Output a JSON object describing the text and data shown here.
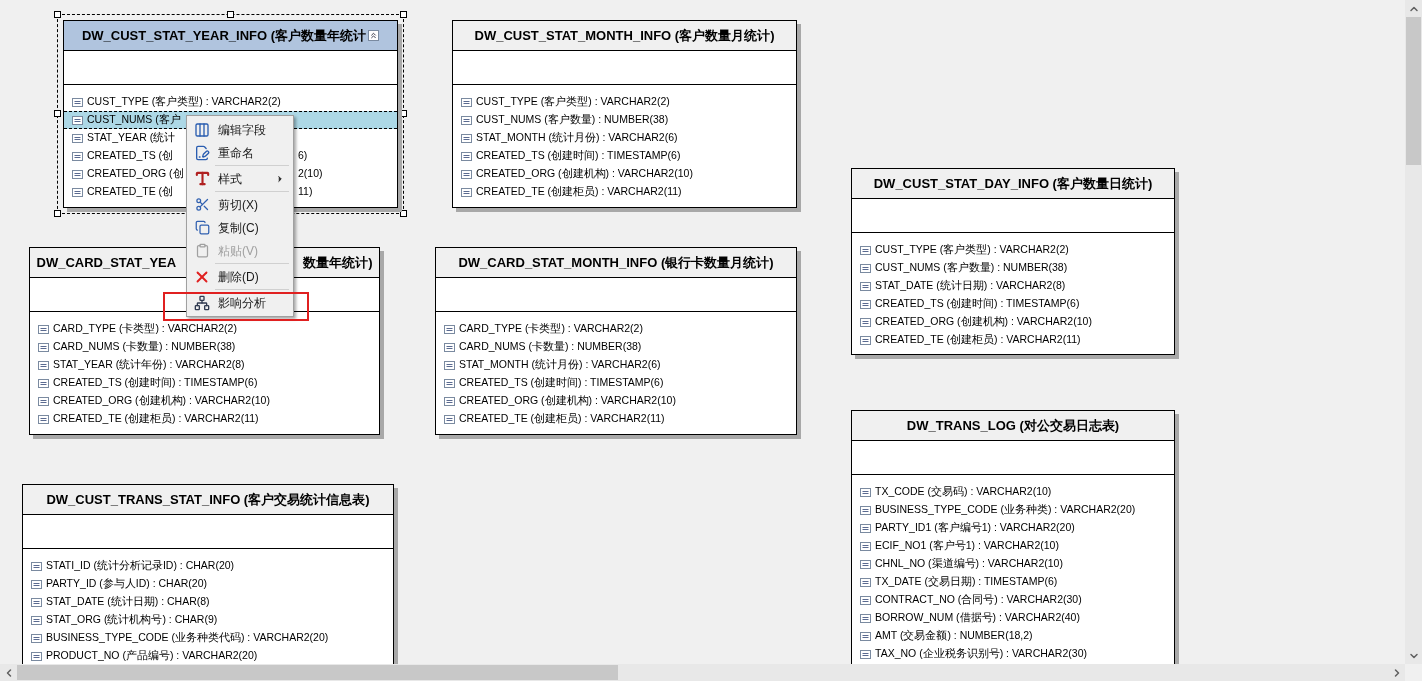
{
  "entities": [
    {
      "title": "DW_CUST_STAT_YEAR_INFO (客户数量年统计",
      "selected": true,
      "collapse_button": true,
      "rows": [
        {
          "text": "CUST_TYPE (客户类型) : VARCHAR2(2)",
          "selected": false
        },
        {
          "text": "CUST_NUMS (客户",
          "selected": true
        },
        {
          "text": "STAT_YEAR (统计",
          "selected": false
        },
        {
          "text": "CREATED_TS (创",
          "tail": "6)",
          "selected": false
        },
        {
          "text": "CREATED_ORG (创",
          "tail": "2(10)",
          "selected": false
        },
        {
          "text": "CREATED_TE (创",
          "tail": "11)",
          "selected": false
        }
      ]
    },
    {
      "title": "DW_CUST_STAT_MONTH_INFO (客户数量月统计)",
      "selected": false,
      "rows": [
        {
          "text": "CUST_TYPE (客户类型) : VARCHAR2(2)",
          "selected": false
        },
        {
          "text": "CUST_NUMS (客户数量) : NUMBER(38)",
          "selected": false
        },
        {
          "text": "STAT_MONTH (统计月份) : VARCHAR2(6)",
          "selected": false
        },
        {
          "text": "CREATED_TS (创建时间) : TIMESTAMP(6)",
          "selected": false
        },
        {
          "text": "CREATED_ORG (创建机构) : VARCHAR2(10)",
          "selected": false
        },
        {
          "text": "CREATED_TE (创建柜员) : VARCHAR2(11)",
          "selected": false
        }
      ]
    },
    {
      "title": "DW_CUST_STAT_DAY_INFO (客户数量日统计)",
      "selected": false,
      "rows": [
        {
          "text": "CUST_TYPE (客户类型) : VARCHAR2(2)",
          "selected": false
        },
        {
          "text": "CUST_NUMS (客户数量) : NUMBER(38)",
          "selected": false
        },
        {
          "text": "STAT_DATE (统计日期) : VARCHAR2(8)",
          "selected": false
        },
        {
          "text": "CREATED_TS (创建时间) : TIMESTAMP(6)",
          "selected": false
        },
        {
          "text": "CREATED_ORG (创建机构) : VARCHAR2(10)",
          "selected": false
        },
        {
          "text": "CREATED_TE (创建柜员) : VARCHAR2(11)",
          "selected": false
        }
      ]
    },
    {
      "title": "DW_CARD_STAT_YEA",
      "title_tail": "数量年统计)",
      "selected": false,
      "rows": [
        {
          "text": "CARD_TYPE (卡类型) : VARCHAR2(2)",
          "selected": false
        },
        {
          "text": "CARD_NUMS (卡数量) : NUMBER(38)",
          "selected": false
        },
        {
          "text": "STAT_YEAR (统计年份) : VARCHAR2(8)",
          "selected": false
        },
        {
          "text": "CREATED_TS (创建时间) : TIMESTAMP(6)",
          "selected": false
        },
        {
          "text": "CREATED_ORG (创建机构) : VARCHAR2(10)",
          "selected": false
        },
        {
          "text": "CREATED_TE (创建柜员) : VARCHAR2(11)",
          "selected": false
        }
      ]
    },
    {
      "title": "DW_CARD_STAT_MONTH_INFO (银行卡数量月统计)",
      "selected": false,
      "rows": [
        {
          "text": "CARD_TYPE (卡类型) : VARCHAR2(2)",
          "selected": false
        },
        {
          "text": "CARD_NUMS (卡数量) : NUMBER(38)",
          "selected": false
        },
        {
          "text": "STAT_MONTH (统计月份) : VARCHAR2(6)",
          "selected": false
        },
        {
          "text": "CREATED_TS (创建时间) : TIMESTAMP(6)",
          "selected": false
        },
        {
          "text": "CREATED_ORG (创建机构) : VARCHAR2(10)",
          "selected": false
        },
        {
          "text": "CREATED_TE (创建柜员) : VARCHAR2(11)",
          "selected": false
        }
      ]
    },
    {
      "title": "DW_CUST_TRANS_STAT_INFO (客户交易统计信息表)",
      "selected": false,
      "rows": [
        {
          "text": "STATI_ID (统计分析记录ID) : CHAR(20)",
          "selected": false
        },
        {
          "text": "PARTY_ID (参与人ID) : CHAR(20)",
          "selected": false
        },
        {
          "text": "STAT_DATE (统计日期) : CHAR(8)",
          "selected": false
        },
        {
          "text": "STAT_ORG (统计机构号) : CHAR(9)",
          "selected": false
        },
        {
          "text": "BUSINESS_TYPE_CODE (业务种类代码) : VARCHAR2(20)",
          "selected": false
        },
        {
          "text": "PRODUCT_NO (产品编号) : VARCHAR2(20)",
          "selected": false
        }
      ]
    },
    {
      "title": "DW_TRANS_LOG (对公交易日志表)",
      "selected": false,
      "rows": [
        {
          "text": "TX_CODE (交易码) : VARCHAR2(10)",
          "selected": false
        },
        {
          "text": "BUSINESS_TYPE_CODE (业务种类) : VARCHAR2(20)",
          "selected": false
        },
        {
          "text": "PARTY_ID1 (客户编号1) : VARCHAR2(20)",
          "selected": false
        },
        {
          "text": "ECIF_NO1 (客户号1) : VARCHAR2(10)",
          "selected": false
        },
        {
          "text": "CHNL_NO (渠道编号) : VARCHAR2(10)",
          "selected": false
        },
        {
          "text": "TX_DATE (交易日期) : TIMESTAMP(6)",
          "selected": false
        },
        {
          "text": "CONTRACT_NO (合同号) : VARCHAR2(30)",
          "selected": false
        },
        {
          "text": "BORROW_NUM (借据号) : VARCHAR2(40)",
          "selected": false
        },
        {
          "text": "AMT (交易金额) : NUMBER(18,2)",
          "selected": false
        },
        {
          "text": "TAX_NO (企业税务识别号) : VARCHAR2(30)",
          "selected": false
        }
      ]
    }
  ],
  "context_menu": {
    "items": [
      {
        "kind": "edit_fields",
        "label": "编辑字段",
        "disabled": false,
        "submenu": false,
        "annotated": false
      },
      {
        "kind": "rename",
        "label": "重命名",
        "disabled": false,
        "submenu": false,
        "annotated": false
      },
      {
        "kind": "separator"
      },
      {
        "kind": "style",
        "label": "样式",
        "disabled": false,
        "submenu": true,
        "annotated": false
      },
      {
        "kind": "separator"
      },
      {
        "kind": "cut",
        "label": "剪切(X)",
        "disabled": false,
        "submenu": false,
        "annotated": false
      },
      {
        "kind": "copy",
        "label": "复制(C)",
        "disabled": false,
        "submenu": false,
        "annotated": false
      },
      {
        "kind": "paste",
        "label": "粘贴(V)",
        "disabled": true,
        "submenu": false,
        "annotated": false
      },
      {
        "kind": "separator"
      },
      {
        "kind": "delete",
        "label": "删除(D)",
        "disabled": false,
        "submenu": false,
        "annotated": false
      },
      {
        "kind": "separator"
      },
      {
        "kind": "impact",
        "label": "影响分析",
        "disabled": false,
        "submenu": false,
        "annotated": true
      }
    ]
  }
}
